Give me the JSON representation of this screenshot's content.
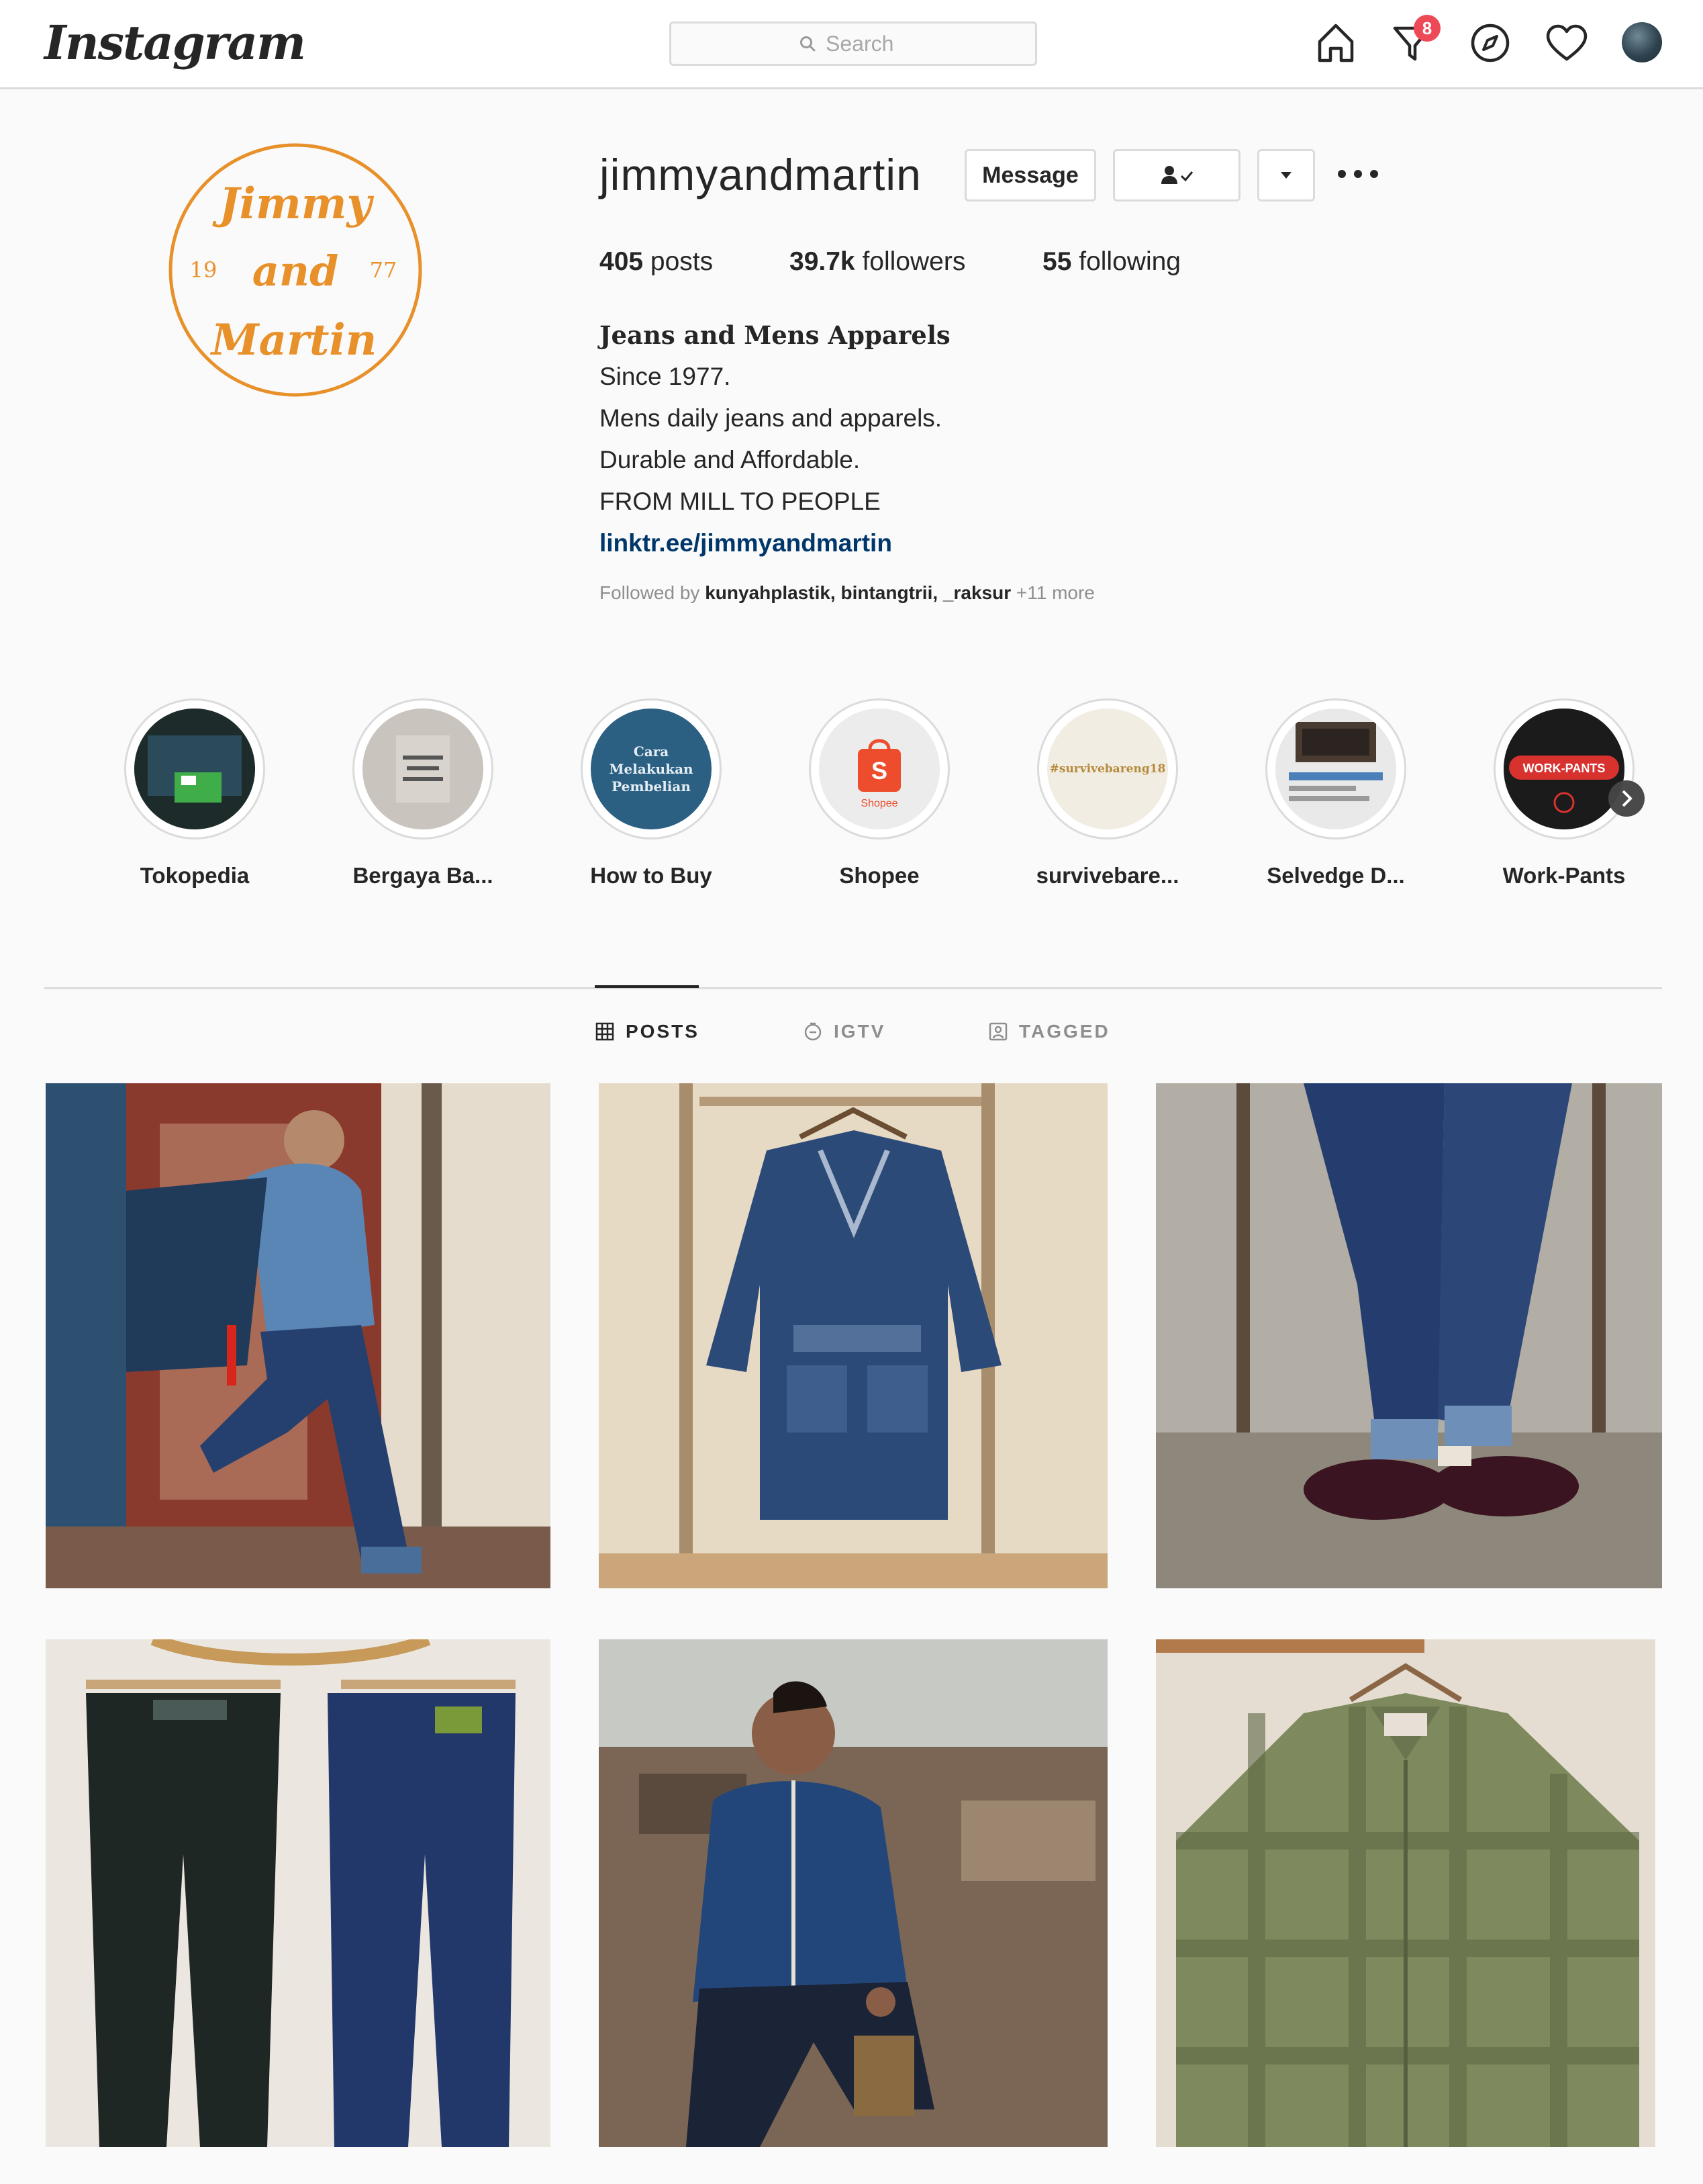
{
  "nav": {
    "logo": "Instagram",
    "search_placeholder": "Search",
    "notification_count": "8",
    "icons": [
      "home-icon",
      "direct-message-icon",
      "explore-icon",
      "activity-heart-icon",
      "profile-avatar-icon"
    ]
  },
  "profile": {
    "logo_text_top": "Jimmy",
    "logo_text_mid": "and",
    "logo_text_bottom": "Martin",
    "logo_year_left": "19",
    "logo_year_right": "77",
    "username": "jimmyandmartin",
    "message_label": "Message",
    "stats": {
      "posts_count": "405",
      "posts_label": "posts",
      "followers_count": "39.7k",
      "followers_label": "followers",
      "following_count": "55",
      "following_label": "following"
    },
    "bio": {
      "name": "Jeans and Mens Apparels",
      "line1": "Since 1977.",
      "line2": "Mens daily jeans and apparels.",
      "line3": "Durable and Affordable.",
      "line4": "FROM MILL TO PEOPLE",
      "link": "linktr.ee/jimmyandmartin"
    },
    "followed_by": {
      "prefix": "Followed by",
      "names": "kunyahplastik, bintangtrii, _raksur",
      "more": "+11 more"
    }
  },
  "highlights": [
    {
      "label": "Tokopedia"
    },
    {
      "label": "Bergaya Ba..."
    },
    {
      "label": "How to Buy",
      "cover_text": "Cara Melakukan Pembelian"
    },
    {
      "label": "Shopee",
      "cover_text": "Shopee"
    },
    {
      "label": "survivebare...",
      "cover_text": "#survivebareng18"
    },
    {
      "label": "Selvedge D..."
    },
    {
      "label": "Work-Pants",
      "cover_text": "WORK-PANTS"
    }
  ],
  "tabs": [
    {
      "label": "POSTS",
      "active": true
    },
    {
      "label": "IGTV",
      "active": false
    },
    {
      "label": "TAGGED",
      "active": false
    }
  ],
  "colors": {
    "logo_orange": "#e8902a",
    "badge_red": "#ed4956",
    "link_blue": "#00376b",
    "border": "#dbdbdb"
  }
}
